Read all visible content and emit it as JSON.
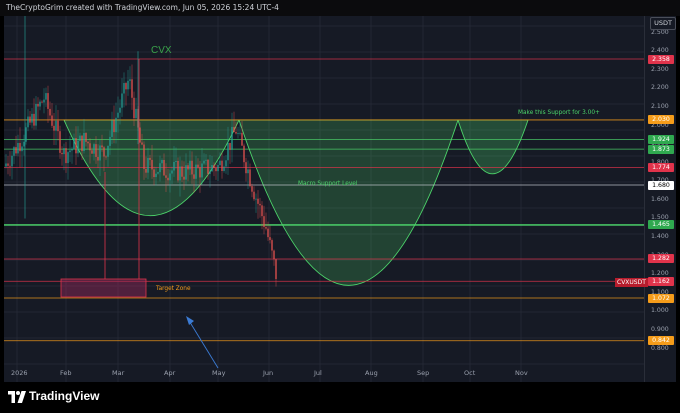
{
  "header": {
    "text": "TheCryptoGrim created with TradingView.com, Jun 05, 2026 15:24 UTC-4"
  },
  "symbol": {
    "title": "CVX",
    "ticker": "CVXUSDT"
  },
  "currency": "USDT",
  "price_axis": {
    "ticks": [
      "2.500",
      "2.400",
      "2.300",
      "2.200",
      "2.100",
      "2.000",
      "1.900",
      "1.800",
      "1.700",
      "1.600",
      "1.500",
      "1.465",
      "1.400",
      "1.300",
      "1.200",
      "1.100",
      "1.000",
      "0.900",
      "0.800"
    ],
    "tick_values": [
      2.5,
      2.4,
      2.3,
      2.2,
      2.1,
      2.0,
      1.9,
      1.8,
      1.7,
      1.6,
      1.5,
      1.465,
      1.4,
      1.3,
      1.2,
      1.1,
      1.0,
      0.9,
      0.8
    ]
  },
  "levels": [
    {
      "label": "2.358",
      "value": 2.358,
      "bg": "#e0334b",
      "line": "#e0334b"
    },
    {
      "label": "2.030",
      "value": 2.03,
      "bg": "#f59c1a",
      "line": "#f59c1a"
    },
    {
      "label": "1.924",
      "value": 1.924,
      "bg": "#2fa84f",
      "line": "#4cd46a"
    },
    {
      "label": "1.873",
      "value": 1.873,
      "bg": "#2fa84f",
      "line": "#4cd46a"
    },
    {
      "label": "1.774",
      "value": 1.774,
      "bg": "#e0334b",
      "line": "#e0334b"
    },
    {
      "label": "1.680",
      "value": 1.68,
      "bg": "#ffffff",
      "line": "#c9ccd3",
      "fg": "#000"
    },
    {
      "label": "1.465",
      "value": 1.465,
      "bg": "#2fa84f",
      "line": "#4cd46a"
    },
    {
      "label": "1.282",
      "value": 1.282,
      "bg": "#e0334b",
      "line": "#e0334b"
    },
    {
      "label": "1.162",
      "value": 1.162,
      "bg": "#e0334b",
      "line": "#e0334b"
    },
    {
      "label": "1.072",
      "value": 1.072,
      "bg": "#f59c1a",
      "line": "#f59c1a"
    },
    {
      "label": "0.842",
      "value": 0.842,
      "bg": "#f59c1a",
      "line": "#f59c1a"
    }
  ],
  "annotations": {
    "target_zone": "Target Zone",
    "macro_support": "Macro Support Level",
    "make_support": "Make this Support for 3.00+"
  },
  "time_axis": [
    "2026",
    "Feb",
    "Mar",
    "Apr",
    "May",
    "Jun",
    "Jul",
    "Aug",
    "Sep",
    "Oct",
    "Nov"
  ],
  "footer": {
    "brand": "TradingView"
  },
  "colors": {
    "bg": "#161a25",
    "up": "#26a69a",
    "down": "#ef5350",
    "green": "#4cd46a"
  },
  "icons": {
    "logo": "tradingview-logo-icon"
  }
}
